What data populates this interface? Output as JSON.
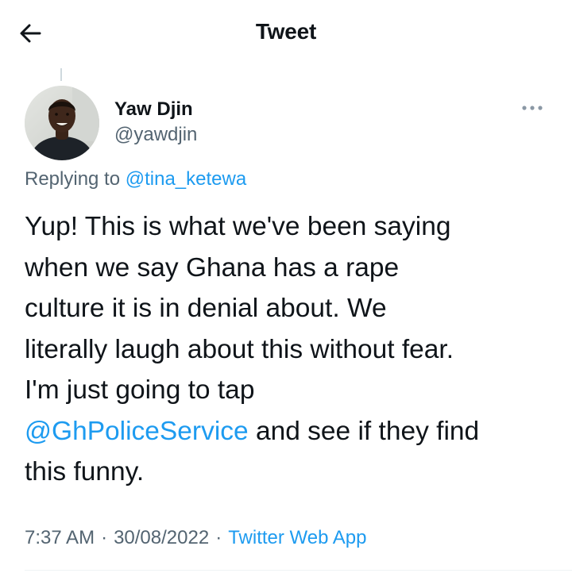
{
  "header": {
    "title": "Tweet",
    "back_icon": "arrow-left-icon"
  },
  "tweet": {
    "author": {
      "name": "Yaw Djin",
      "handle": "@yawdjin",
      "avatar_icon": "profile-photo"
    },
    "more_icon": "more-horizontal-icon",
    "replying_prefix": "Replying to",
    "replying_to": "@tina_ketewa",
    "body": {
      "line1": "Yup! This is what we've been saying",
      "line2": "when we say Ghana has a rape",
      "line3": "culture it is in denial about. We",
      "line4": "literally laugh about this without fear.",
      "line5": "I'm just going to tap",
      "line6_mention": "@GhPoliceService",
      "line6_rest": " and see if they find",
      "line7": "this funny."
    },
    "meta": {
      "time": "7:37 AM",
      "date": "30/08/2022",
      "separator": "·",
      "source": "Twitter Web App"
    }
  },
  "colors": {
    "text": "#0f1419",
    "secondary": "#536471",
    "link": "#1d9bf0"
  }
}
